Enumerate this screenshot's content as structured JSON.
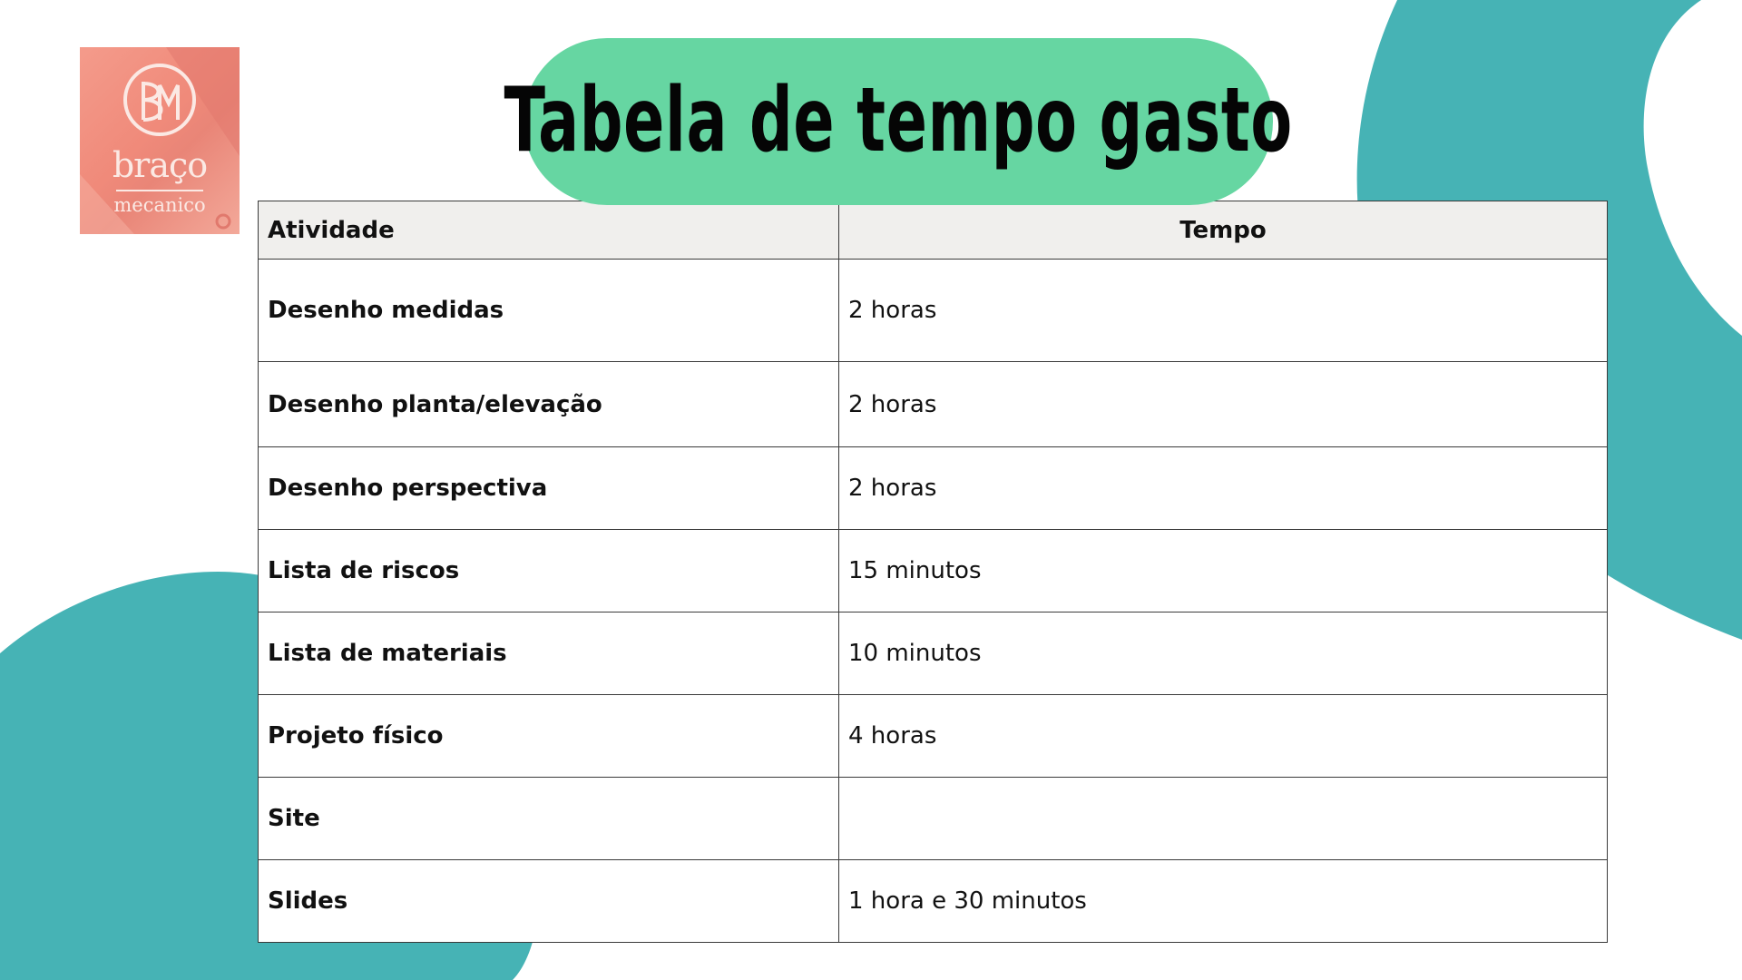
{
  "colors": {
    "background": "#ffffff",
    "teal_accent": "#46b3b5",
    "title_pill": "#66d6a2",
    "header_fill": "#f0efed",
    "logo_fill": "#f08a7a"
  },
  "logo": {
    "word1": "braço",
    "word2": "mecanico",
    "icon": "monogram-circle-icon"
  },
  "title": "Tabela de tempo gasto",
  "table": {
    "headers": [
      "Atividade",
      "Tempo"
    ],
    "rows": [
      {
        "activity": "Desenho medidas",
        "time": "2 horas"
      },
      {
        "activity": "Desenho planta/elevação",
        "time": "2 horas"
      },
      {
        "activity": "Desenho perspectiva",
        "time": "2 horas"
      },
      {
        "activity": "Lista de riscos",
        "time": "15 minutos"
      },
      {
        "activity": "Lista de materiais",
        "time": "10 minutos"
      },
      {
        "activity": "Projeto físico",
        "time": "4 horas"
      },
      {
        "activity": "Site",
        "time": ""
      },
      {
        "activity": "Slides",
        "time": "1 hora e 30 minutos"
      }
    ]
  }
}
